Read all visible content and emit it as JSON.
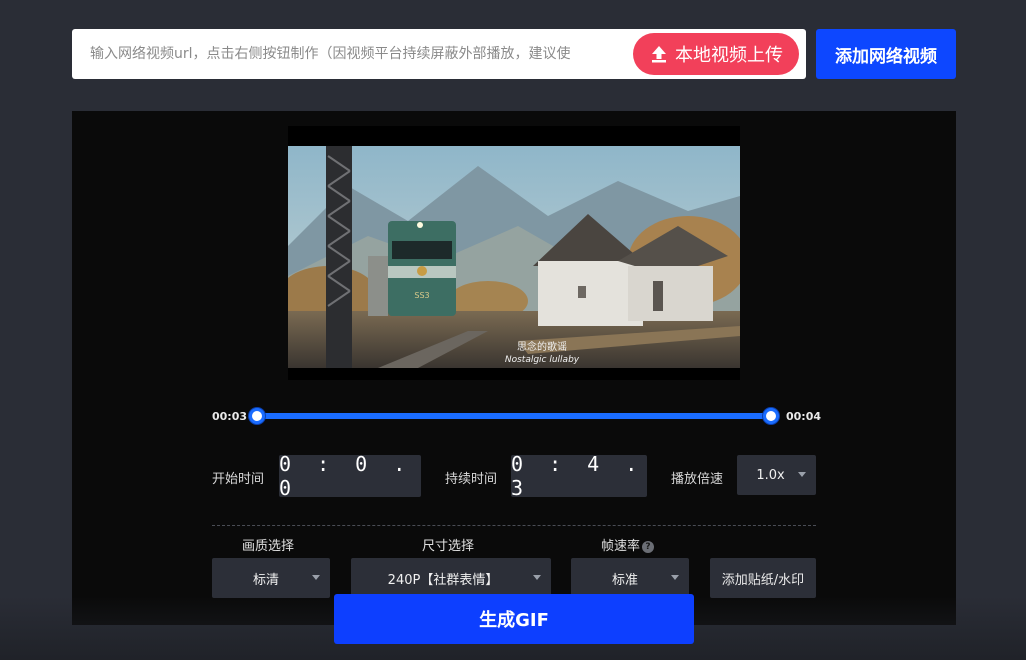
{
  "url_input": {
    "placeholder": "输入网络视频url，点击右侧按钮制作（因视频平台持续屏蔽外部播放，建议使"
  },
  "upload_button": {
    "label": "本地视频上传",
    "icon": "upload-icon",
    "color": "#f2405a"
  },
  "add_network_button": {
    "label": "添加网络视频",
    "color": "#0d47ff"
  },
  "video": {
    "subtitle_cn": "思念的歌谣",
    "subtitle_en": "Nostalgic lullaby",
    "train_plate": "SS3"
  },
  "range": {
    "start_label": "00:03",
    "end_label": "00:04",
    "accent": "#1a6cff"
  },
  "timing": {
    "start_label": "开始时间",
    "start_value": "0 : 0 . 0",
    "duration_label": "持续时间",
    "duration_value": "0 : 4 . 3",
    "speed_label": "播放倍速",
    "speed_value": "1.0x"
  },
  "options": {
    "quality_title": "画质选择",
    "quality_value": "标清",
    "size_title": "尺寸选择",
    "size_value": "240P【社群表情】",
    "fps_title": "帧速率",
    "fps_help": "?",
    "fps_value": "标准",
    "sticker_label": "添加贴纸/水印"
  },
  "generate_button": {
    "label": "生成GIF",
    "color": "#0d3fff"
  }
}
